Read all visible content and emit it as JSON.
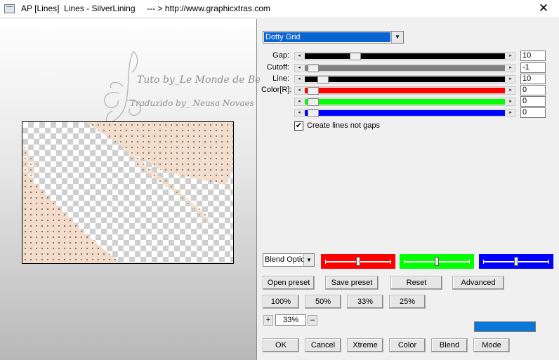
{
  "window": {
    "title": "AP [Lines]  Lines - SilverLining     --- > http://www.graphicxtras.com",
    "close_glyph": "✕"
  },
  "watermark": {
    "line1": "Tuto by_Le Monde de Bea",
    "line2": "Traduzido by_ Neusa Novaes"
  },
  "effect_select": {
    "value": "Dotty Grid"
  },
  "sliders": [
    {
      "label": "Gap:",
      "value": "10",
      "fill": "#000000",
      "thumb_pos": 0.23
    },
    {
      "label": "Cutoff:",
      "value": "-1",
      "fill": "#808080",
      "thumb_pos": 0.02
    },
    {
      "label": "Line:",
      "value": "10",
      "fill": "#000000",
      "thumb_pos": 0.07
    },
    {
      "label": "Color[R]:",
      "value": "0",
      "fill": "#ff0000",
      "thumb_pos": 0.02
    },
    {
      "label": "",
      "value": "0",
      "fill": "#00ff00",
      "thumb_pos": 0.02
    },
    {
      "label": "",
      "value": "0",
      "fill": "#0000ff",
      "thumb_pos": 0.02
    }
  ],
  "checkbox": {
    "label": "Create lines not gaps",
    "checked": true,
    "mark": "✔"
  },
  "blend_select": {
    "value": "Blend Options"
  },
  "color_sliders": [
    {
      "color": "#ff0000",
      "level": 0.5
    },
    {
      "color": "#00ff00",
      "level": 0.5
    },
    {
      "color": "#0000ff",
      "level": 0.5
    }
  ],
  "preset_buttons": [
    "Open preset",
    "Save preset",
    "Reset",
    "Advanced"
  ],
  "zoom_buttons": [
    "100%",
    "50%",
    "33%",
    "25%"
  ],
  "zoom": {
    "plus": "+",
    "minus": "–",
    "value": "33%"
  },
  "swatch_color": "#0a78d7",
  "bottom_buttons": [
    "OK",
    "Cancel",
    "Xtreme",
    "Color",
    "Blend",
    "Mode"
  ]
}
